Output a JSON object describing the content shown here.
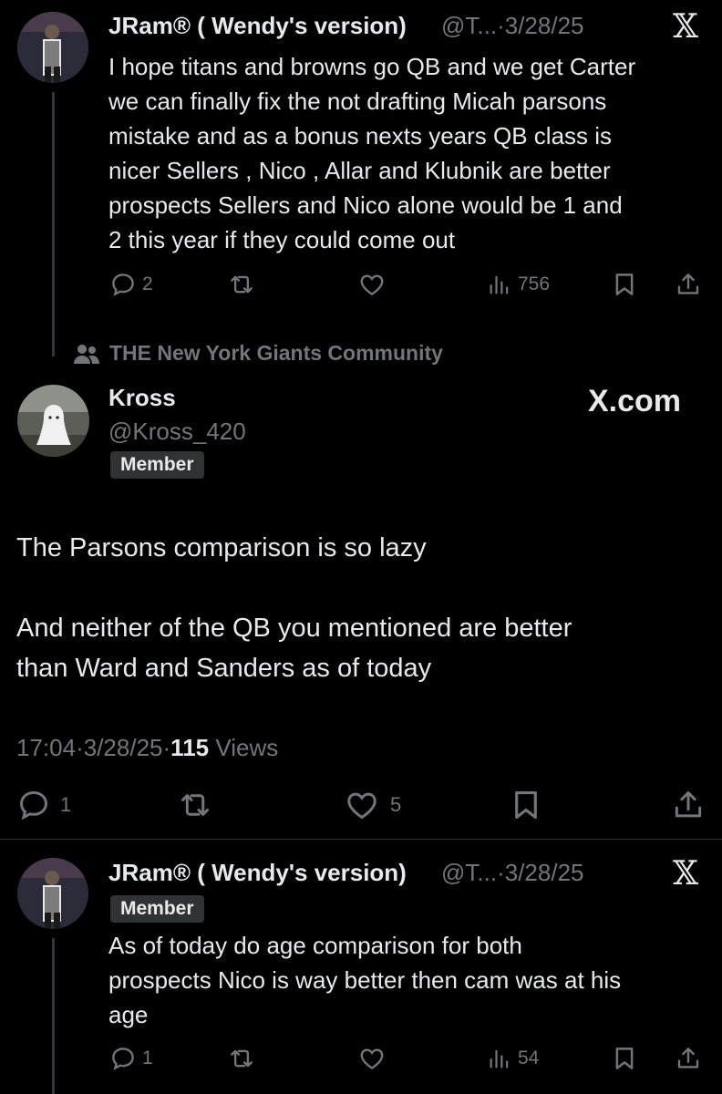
{
  "tweet1": {
    "display_name": "JRam® ( Wendy's version)",
    "handle": "@T...",
    "date_sep": "·",
    "date": "3/28/25",
    "text_lines": [
      "I hope titans and browns go QB and we get Carter",
      "we can finally fix the not drafting Micah parsons",
      "mistake and as a bonus nexts years QB class is",
      "nicer Sellers , Nico , Allar and Klubnik are better",
      "prospects Sellers and Nico alone would be 1 and",
      "2 this year if they could come out"
    ],
    "replies": "2",
    "views": "756"
  },
  "community": {
    "label": "THE New York Giants Community"
  },
  "main_tweet": {
    "display_name": "Kross",
    "handle": "@Kross_420",
    "badge": "Member",
    "site_label": "X.com",
    "text_line1": "The Parsons comparison is so lazy",
    "text_line2": "And neither of the QB you mentioned are better",
    "text_line3": "than Ward and Sanders as of today",
    "time": "17:04",
    "sep1": "·",
    "date": "3/28/25",
    "sep2": "·",
    "views_count": "115",
    "views_label": "Views",
    "replies": "1",
    "likes": "5"
  },
  "tweet3": {
    "display_name": "JRam® ( Wendy's version)",
    "handle": "@T...",
    "date_sep": "·",
    "date": "3/28/25",
    "badge": "Member",
    "text_lines": [
      "As of today do age comparison for both",
      "prospects Nico is way better then cam was at his",
      "age"
    ],
    "replies": "1",
    "views": "54"
  },
  "icons": {
    "x_logo": "𝕏",
    "reply": "reply-icon",
    "retweet": "retweet-icon",
    "like": "heart-icon",
    "views": "analytics-icon",
    "bookmark": "bookmark-icon",
    "share": "share-icon",
    "community": "people-icon"
  },
  "colors": {
    "background": "#000000",
    "text": "#e7e9ea",
    "muted": "#71767b",
    "badge_bg": "#2f3336"
  }
}
